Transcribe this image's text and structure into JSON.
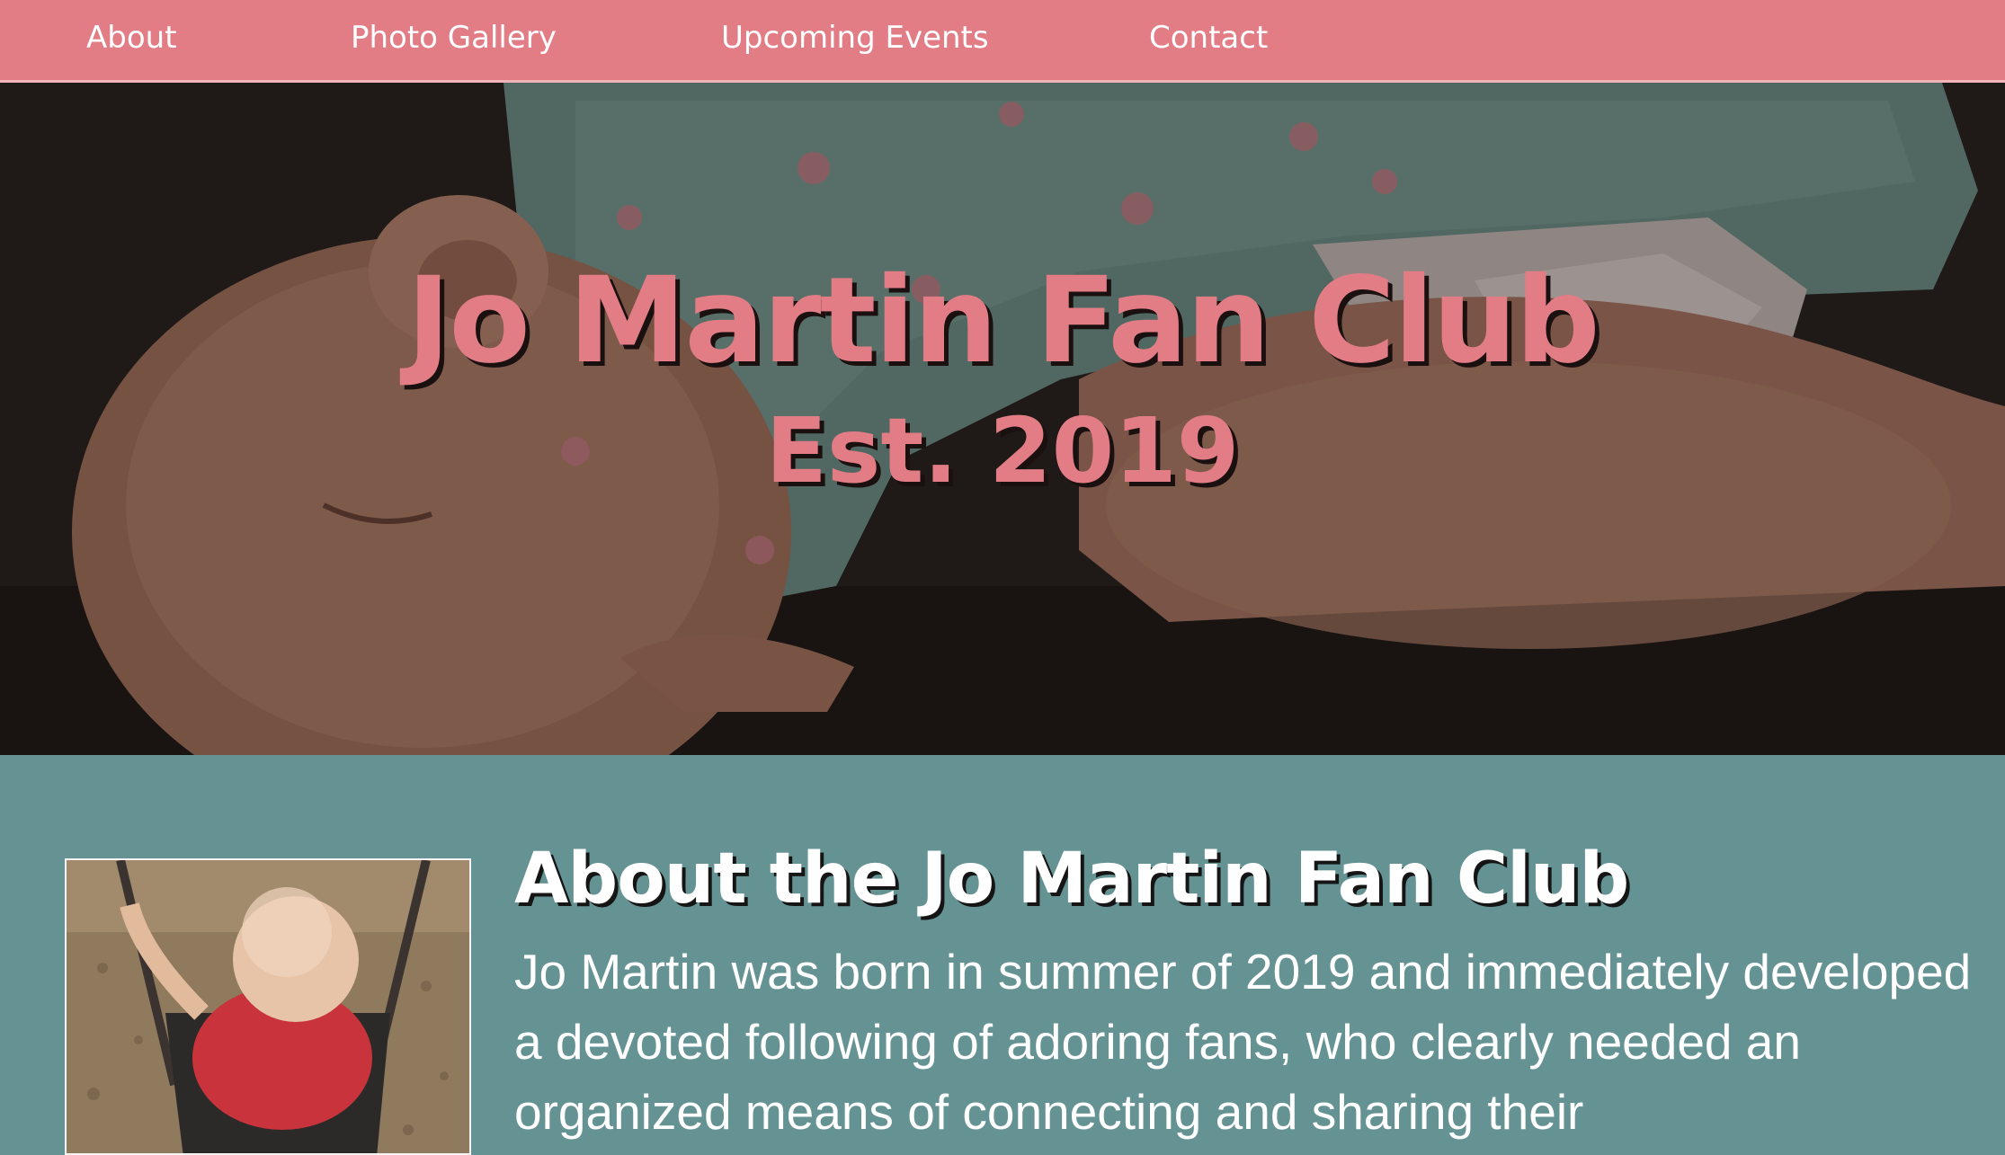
{
  "nav": {
    "items": [
      {
        "label": "About"
      },
      {
        "label": "Photo Gallery"
      },
      {
        "label": "Upcoming Events"
      },
      {
        "label": "Contact"
      }
    ]
  },
  "hero": {
    "title": "Jo Martin Fan Club",
    "subtitle": "Est. 2019"
  },
  "about": {
    "heading": "About the Jo Martin Fan Club",
    "paragraph": "Jo Martin was born in summer of 2019 and immediately developed a devoted following of adoring fans, who clearly needed an organized means of connecting and sharing their"
  },
  "colors": {
    "accent_pink": "#e27d86",
    "teal_background": "#659394",
    "hero_dark": "#2a211f",
    "text_white": "#ffffff"
  }
}
